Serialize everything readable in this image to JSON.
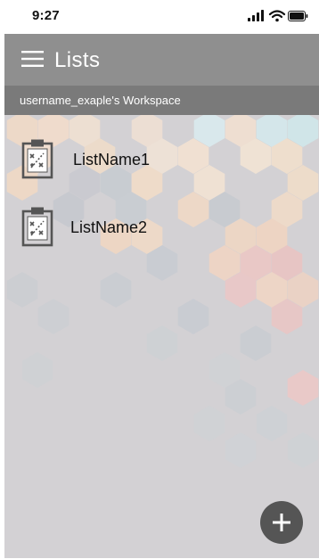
{
  "status_bar": {
    "time": "9:27",
    "icons": [
      "signal-icon",
      "wifi-icon",
      "battery-icon"
    ]
  },
  "app_bar": {
    "title": "Lists",
    "menu_icon": "hamburger-menu-icon",
    "background": "#8f8f8f"
  },
  "workspace": {
    "label": "username_exaple's Workspace",
    "background": "#7a7a7a"
  },
  "lists": [
    {
      "name": "ListName1",
      "icon": "clipboard-icon"
    },
    {
      "name": "ListName2",
      "icon": "clipboard-icon"
    }
  ],
  "fab": {
    "icon": "plus-icon",
    "color": "#555555"
  },
  "colors": {
    "content_background": "#d3d1d4",
    "text": "#111111"
  }
}
